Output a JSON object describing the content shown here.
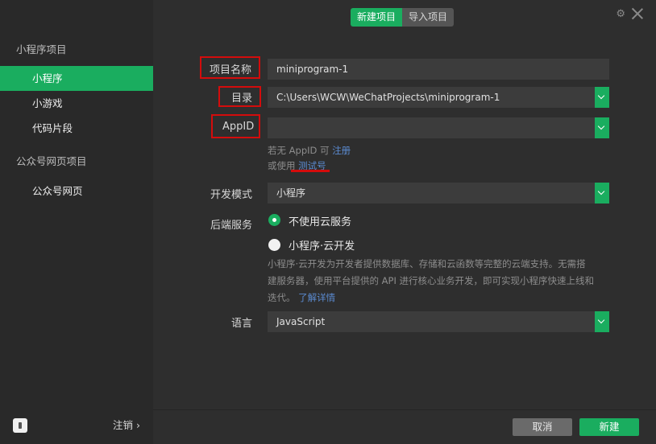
{
  "sidebar": {
    "group1": "小程序项目",
    "items1": [
      "小程序",
      "小游戏",
      "代码片段"
    ],
    "group2": "公众号网页项目",
    "items2": [
      "公众号网页"
    ],
    "logout": "注销 ›"
  },
  "tabs": {
    "new": "新建项目",
    "import": "导入项目"
  },
  "form": {
    "project_name_label": "项目名称",
    "project_name_value": "miniprogram-1",
    "dir_label": "目录",
    "dir_value": "C:\\Users\\WCW\\WeChatProjects\\miniprogram-1",
    "appid_label": "AppID",
    "appid_value": "",
    "hint1_prefix": "若无 AppID 可",
    "hint1_link": "注册",
    "hint2_prefix": "或使用",
    "hint2_link": "测试号",
    "devmode_label": "开发模式",
    "devmode_value": "小程序",
    "backend_label": "后端服务",
    "backend_opt1": "不使用云服务",
    "backend_opt2": "小程序·云开发",
    "desc_line1": "小程序·云开发为开发者提供数据库、存储和云函数等完整的云端支持。无需搭",
    "desc_line2": "建服务器，使用平台提供的 API 进行核心业务开发，即可实现小程序快速上线和",
    "desc_line3": "迭代。",
    "desc_link": "了解详情",
    "lang_label": "语言",
    "lang_value": "JavaScript"
  },
  "footer": {
    "cancel": "取消",
    "create": "新建"
  },
  "colors": {
    "accent": "#1aad5f",
    "highlight": "#d40c0c"
  }
}
